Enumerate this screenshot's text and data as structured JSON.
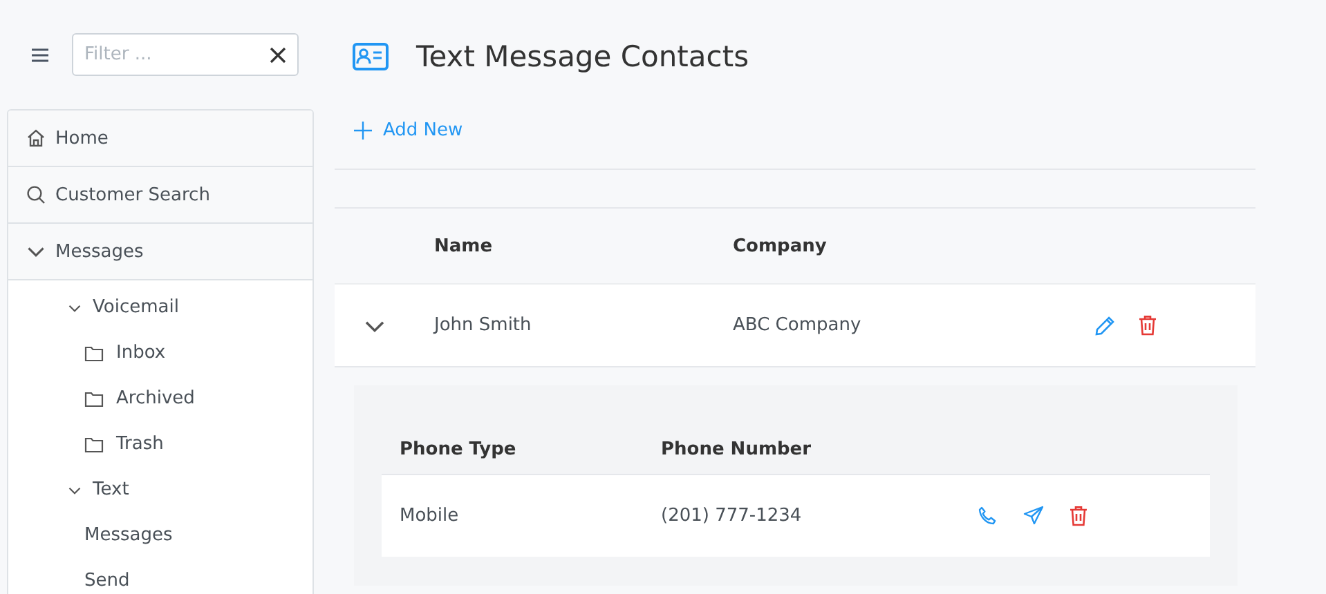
{
  "filter": {
    "placeholder": "Filter ..."
  },
  "nav": [
    {
      "label": "Home",
      "kind": "home"
    },
    {
      "label": "Customer Search",
      "kind": "search"
    },
    {
      "label": "Messages",
      "kind": "group",
      "expanded": true,
      "children": [
        {
          "label": "Voicemail",
          "kind": "group",
          "expanded": true,
          "children": [
            {
              "label": "Inbox",
              "kind": "folder"
            },
            {
              "label": "Archived",
              "kind": "folder"
            },
            {
              "label": "Trash",
              "kind": "folder"
            }
          ]
        },
        {
          "label": "Text",
          "kind": "group",
          "expanded": true,
          "children": [
            {
              "label": "Messages",
              "kind": "link"
            },
            {
              "label": "Send",
              "kind": "link"
            }
          ]
        }
      ]
    }
  ],
  "page": {
    "title": "Text Message Contacts",
    "add_button": "Add New"
  },
  "table": {
    "columns": [
      "Name",
      "Company"
    ],
    "rows": [
      {
        "expanded": true,
        "name": "John Smith",
        "company": "ABC Company",
        "phones": {
          "columns": [
            "Phone Type",
            "Phone Number"
          ],
          "rows": [
            {
              "type": "Mobile",
              "number": "(201) 777-1234"
            }
          ]
        }
      }
    ]
  }
}
